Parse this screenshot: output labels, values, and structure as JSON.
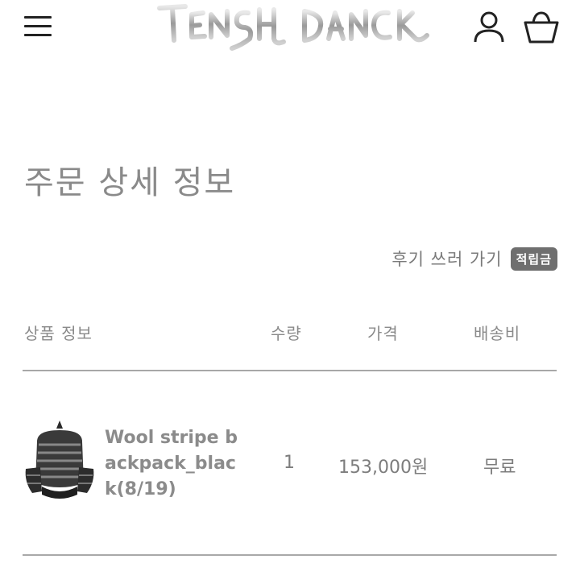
{
  "header": {
    "logo_text": "TENSE DANCE",
    "menu_icon": "hamburger-menu-icon",
    "account_icon": "user-icon",
    "cart_icon": "shopping-basket-icon"
  },
  "page": {
    "title": "주문 상세 정보"
  },
  "review": {
    "link_label": "후기 쓰러 가기",
    "badge_label": "적립금"
  },
  "table": {
    "columns": [
      "상품 정보",
      "수량",
      "가격",
      "배송비"
    ],
    "rows": [
      {
        "product_name": "Wool stripe backpack_black(8/19)",
        "quantity": "1",
        "price": "153,000원",
        "shipping": "무료"
      }
    ]
  },
  "colors": {
    "text": "#7d7d7d",
    "badge_bg": "#6f6f6f",
    "divider": "#a8a8a8",
    "icon": "#222222"
  }
}
